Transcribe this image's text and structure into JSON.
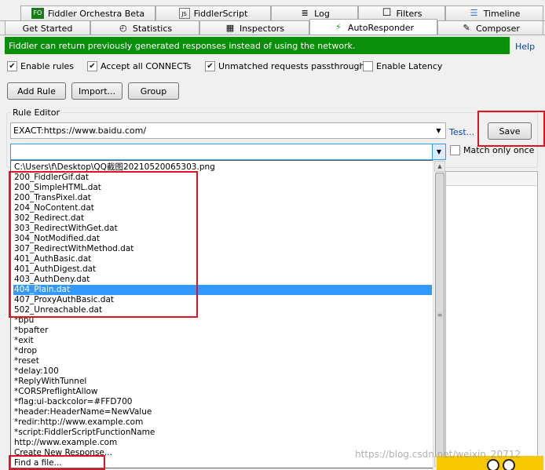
{
  "tabs_row1": [
    {
      "label": "Fiddler Orchestra Beta",
      "icon": "fo-logo-icon",
      "icon_text": "FO"
    },
    {
      "label": "FiddlerScript",
      "icon": "script-icon",
      "icon_text": "JS"
    },
    {
      "label": "Log",
      "icon": "log-icon",
      "icon_text": "≣"
    },
    {
      "label": "Filters",
      "icon": "filter-checkbox-icon",
      "icon_text": "☐"
    },
    {
      "label": "Timeline",
      "icon": "timeline-icon",
      "icon_text": "☰"
    }
  ],
  "tabs_row2": [
    {
      "label": "Get Started",
      "icon": "",
      "icon_text": ""
    },
    {
      "label": "Statistics",
      "icon": "stopwatch-icon",
      "icon_text": "◴"
    },
    {
      "label": "Inspectors",
      "icon": "inspect-icon",
      "icon_text": "▦"
    },
    {
      "label": "AutoResponder",
      "icon": "lightning-icon",
      "icon_text": "⚡"
    },
    {
      "label": "Composer",
      "icon": "composer-icon",
      "icon_text": "✎"
    }
  ],
  "active_tab": "AutoResponder",
  "infobar": {
    "text": "Fiddler can return previously generated responses instead of using the network.",
    "color": "#0a8f0a"
  },
  "help_link": "Help",
  "options": {
    "enable_rules": {
      "label": "Enable rules",
      "checked": true
    },
    "accept_connects": {
      "label": "Accept all CONNECTs",
      "checked": true
    },
    "unmatched_passthrough": {
      "label": "Unmatched requests passthrough",
      "checked": true
    },
    "enable_latency": {
      "label": "Enable Latency",
      "checked": false
    }
  },
  "buttons": {
    "add_rule": "Add Rule",
    "import": "Import...",
    "group": "Group"
  },
  "rule_editor": {
    "title": "Rule Editor",
    "match_value": "EXACT:https://www.baidu.com/",
    "response_value": "",
    "test_link": "Test...",
    "save_label": "Save",
    "match_once_label": "Match only once",
    "match_once_checked": false
  },
  "dropdown_items": [
    "C:\\Users\\f\\Desktop\\QQ截图20210520065303.png",
    "200_FiddlerGif.dat",
    "200_SimpleHTML.dat",
    "200_TransPixel.dat",
    "204_NoContent.dat",
    "302_Redirect.dat",
    "303_RedirectWithGet.dat",
    "304_NotModified.dat",
    "307_RedirectWithMethod.dat",
    "401_AuthBasic.dat",
    "401_AuthDigest.dat",
    "403_AuthDeny.dat",
    "404_Plain.dat",
    "407_ProxyAuthBasic.dat",
    "502_Unreachable.dat",
    "*bpu",
    "*bpafter",
    "*exit",
    "*drop",
    "*reset",
    "*delay:100",
    "*ReplyWithTunnel",
    "*CORSPreflightAllow",
    "*flag:ui-backcolor=#FFD700",
    "*header:HeaderName=NewValue",
    "*redir:http://www.example.com",
    "*script:FiddlerScriptFunctionName",
    "http://www.example.com",
    "Create New Response...",
    "Find a file..."
  ],
  "selected_item": "404_Plain.dat",
  "watermark": "https://blog.csdn.net/weixin_20712",
  "colors": {
    "annotation_red": "#e0141e",
    "selection_blue": "#3399ff",
    "link_blue": "#0645ad"
  }
}
